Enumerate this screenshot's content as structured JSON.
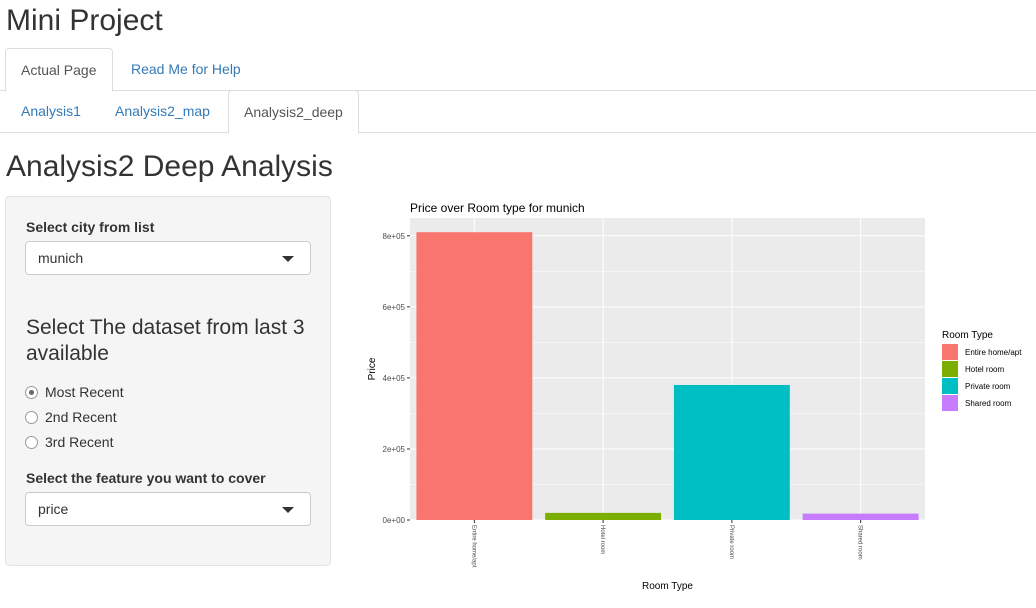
{
  "app": {
    "title": "Mini Project"
  },
  "main_tabs": [
    {
      "label": "Actual Page",
      "active": true
    },
    {
      "label": "Read Me for Help",
      "active": false
    }
  ],
  "sub_tabs": [
    {
      "label": "Analysis1",
      "active": false
    },
    {
      "label": "Analysis2_map",
      "active": false
    },
    {
      "label": "Analysis2_deep",
      "active": true
    }
  ],
  "page": {
    "title": "Analysis2 Deep Analysis"
  },
  "sidebar": {
    "city_label": "Select city from list",
    "city_value": "munich",
    "dataset_label": "Select The dataset from last 3 available",
    "dataset_options": [
      {
        "label": "Most Recent",
        "checked": true
      },
      {
        "label": "2nd Recent",
        "checked": false
      },
      {
        "label": "3rd Recent",
        "checked": false
      }
    ],
    "feature_label": "Select the feature you want to cover",
    "feature_value": "price"
  },
  "colors": {
    "panel_bg": "#ebebeb",
    "grid": "#ffffff",
    "link": "#337ab7"
  },
  "chart_data": {
    "type": "bar",
    "title": "Price over Room type for  munich",
    "xlabel": "Room Type",
    "ylabel": "Price",
    "categories": [
      "Entire home/apt",
      "Hotel room",
      "Private room",
      "Shared room"
    ],
    "values": [
      810000,
      20000,
      380000,
      18000
    ],
    "colors": [
      "#F8766D",
      "#7CAE00",
      "#00BFC4",
      "#C77CFF"
    ],
    "ylim": [
      0,
      850000
    ],
    "yticks": [
      0,
      200000,
      400000,
      600000,
      800000
    ],
    "ytick_labels": [
      "0e+00",
      "2e+05",
      "4e+05",
      "6e+05",
      "8e+05"
    ],
    "legend_title": "Room Type",
    "legend_position": "right",
    "grid": true
  }
}
